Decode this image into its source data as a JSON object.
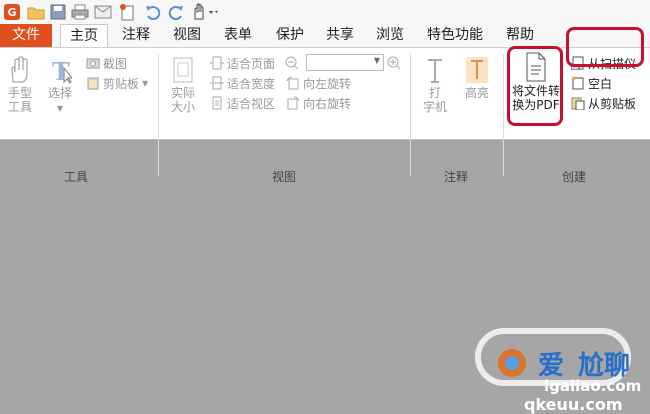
{
  "tabs": {
    "file": "文件",
    "items": [
      "主页",
      "注释",
      "视图",
      "表单",
      "保护",
      "共享",
      "浏览",
      "特色功能",
      "帮助"
    ]
  },
  "ribbon": {
    "tools": {
      "hand_line1": "手型",
      "hand_line2": "工具",
      "select_line1": "选择",
      "screenshot": "截图",
      "clipboard": "剪贴板",
      "group_label": "工具"
    },
    "view": {
      "actual_line1": "实际",
      "actual_line2": "大小",
      "fit_page": "适合页面",
      "fit_width": "适合宽度",
      "fit_visible": "适合视区",
      "rotate_left": "向左旋转",
      "rotate_right": "向右旋转",
      "group_label": "视图"
    },
    "comment": {
      "typewriter_line1": "打",
      "typewriter_line2": "字机",
      "highlight": "高亮",
      "group_label": "注释"
    },
    "create": {
      "convert_line1": "将文件转",
      "convert_line2": "换为PDF",
      "from_scanner": "从扫描仪",
      "blank": "空白",
      "from_clipboard": "从剪贴板",
      "group_label": "创建"
    }
  },
  "watermark": {
    "brand_top": "爱",
    "brand_top2": "尬聊",
    "domain": "igaliao.com",
    "domain2": "qkeuu.com"
  },
  "colors": {
    "accent": "#e0501e",
    "highlight_box": "#c8102e",
    "canvas": "#a6a6a6"
  }
}
